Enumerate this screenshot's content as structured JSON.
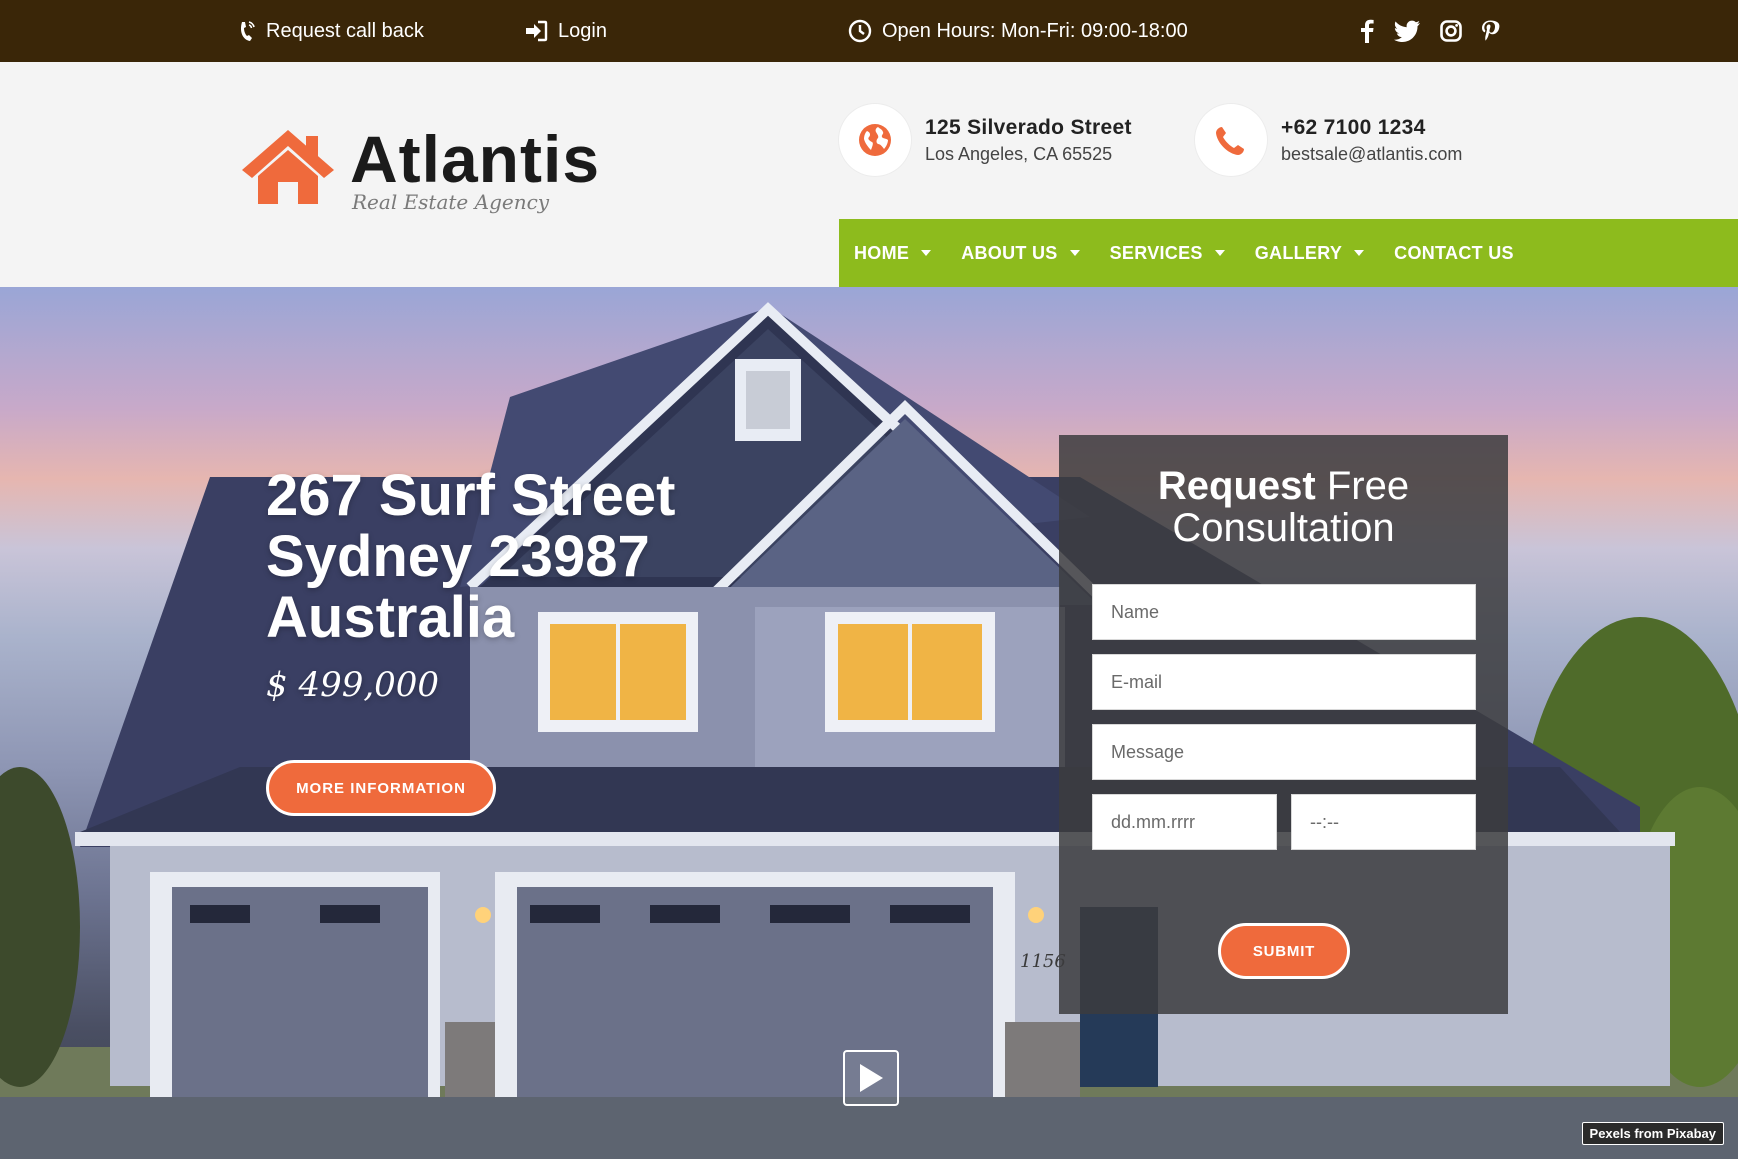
{
  "topbar": {
    "request_call": "Request call back",
    "login": "Login",
    "open_hours": "Open Hours: Mon-Fri: 09:00-18:00",
    "social_icons": [
      "facebook-icon",
      "twitter-icon",
      "instagram-icon",
      "pinterest-icon"
    ]
  },
  "logo": {
    "name": "Atlantis",
    "tagline": "Real Estate Agency"
  },
  "contacts": {
    "address": {
      "line1": "125 Silverado Street",
      "line2": "Los Angeles, CA 65525"
    },
    "phone": {
      "line1": "+62 7100 1234",
      "line2": "bestsale@atlantis.com"
    }
  },
  "nav": {
    "items": [
      {
        "label": "HOME",
        "dropdown": true
      },
      {
        "label": "ABOUT US",
        "dropdown": true
      },
      {
        "label": "SERVICES",
        "dropdown": true
      },
      {
        "label": "GALLERY",
        "dropdown": true
      },
      {
        "label": "CONTACT US",
        "dropdown": false
      }
    ]
  },
  "hero": {
    "title_line1": "267 Surf Street",
    "title_line2": "Sydney 23987",
    "title_line3": "Australia",
    "price": "$ 499,000",
    "more_button": "MORE INFORMATION",
    "credit": "Pexels from Pixabay"
  },
  "form": {
    "title_bold": "Request",
    "title_light1": "Free",
    "title_light2": "Consultation",
    "name_placeholder": "Name",
    "email_placeholder": "E-mail",
    "message_placeholder": "Message",
    "date_placeholder": "dd.mm.rrrr",
    "time_placeholder": "--:--",
    "submit": "SUBMIT"
  },
  "colors": {
    "topbar": "#3a2608",
    "accent": "#ef6a3c",
    "nav": "#8dbb1d"
  }
}
